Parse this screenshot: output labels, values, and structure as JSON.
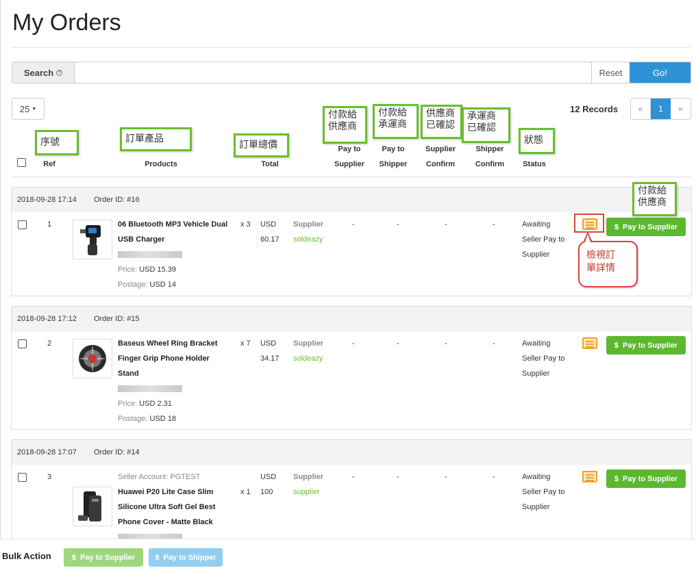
{
  "page": {
    "title": "My Orders"
  },
  "search": {
    "label": "Search",
    "placeholder": "",
    "reset_label": "Reset",
    "go_label": "Go!"
  },
  "pagination": {
    "page_size": "25",
    "records": "12 Records",
    "prev": "«",
    "current": "1",
    "next": "»"
  },
  "columns": {
    "ref": "Ref",
    "products": "Products",
    "total": "Total",
    "pay_to_supplier_1": "Pay to",
    "pay_to_supplier_2": "Supplier",
    "pay_to_shipper_1": "Pay to",
    "pay_to_shipper_2": "Shipper",
    "supplier_confirm_1": "Supplier",
    "supplier_confirm_2": "Confirm",
    "shipper_confirm_1": "Shipper",
    "shipper_confirm_2": "Confirm",
    "status": "Status"
  },
  "annotations": {
    "ref": "序號",
    "products": "訂單產品",
    "total": "訂單總價",
    "pay_supplier_1": "付款給",
    "pay_supplier_2": "供應商",
    "pay_shipper_1": "付款給",
    "pay_shipper_2": "承運商",
    "supplier_confirm_1": "供應商",
    "supplier_confirm_2": "已確認",
    "shipper_confirm_1": "承運商",
    "shipper_confirm_2": "已確認",
    "status": "狀態",
    "pay_btn_1": "付款給",
    "pay_btn_2": "供應商",
    "view_detail_1": "檢視訂",
    "view_detail_2": "單詳情"
  },
  "orders": [
    {
      "date": "2018-09-28 17:14",
      "order_id": "Order ID: #16",
      "ref": "1",
      "name_1": "06 Bluetooth MP3 Vehicle Dual",
      "name_2": "USB Charger",
      "price_label": "Price:",
      "price": "USD 15.39",
      "postage_label": "Postage:",
      "postage": "USD 14",
      "qty": "x 3",
      "currency": "USD",
      "total": "60.17",
      "supplier_label": "Supplier",
      "supplier": "soldeazy",
      "dash": "-",
      "status_1": "Awaiting",
      "status_2": "Seller Pay to",
      "status_3": "Supplier",
      "pay_label": "Pay to Supplier"
    },
    {
      "date": "2018-09-28 17:12",
      "order_id": "Order ID: #15",
      "ref": "2",
      "name_1": "Baseus Wheel Ring Bracket",
      "name_2": "Finger Grip Phone Holder",
      "name_3": "Stand",
      "price_label": "Price:",
      "price": "USD 2.31",
      "postage_label": "Postage:",
      "postage": "USD 18",
      "qty": "x 7",
      "currency": "USD",
      "total": "34.17",
      "supplier_label": "Supplier",
      "supplier": "soldeazy",
      "dash": "-",
      "status_1": "Awaiting",
      "status_2": "Seller Pay to",
      "status_3": "Supplier",
      "pay_label": "Pay to Supplier"
    },
    {
      "date": "2018-09-28 17:07",
      "order_id": "Order ID: #14",
      "ref": "3",
      "seller_account": "Seller Account: PGTEST",
      "name_1": "Huawei P20 Lite Case Slim",
      "name_2": "Silicone Ultra Soft Gel Best",
      "name_3": "Phone Cover - Matte Black",
      "qty": "x 1",
      "currency": "USD",
      "total": "100",
      "supplier_label": "Supplier",
      "supplier": "supplier",
      "dash": "-",
      "status_1": "Awaiting",
      "status_2": "Seller Pay to",
      "status_3": "Supplier",
      "pay_label": "Pay to Supplier"
    }
  ],
  "bulk": {
    "label": "Bulk Action",
    "pay_supplier": "Pay to Supplier",
    "pay_shipper": "Pay to Shipper"
  },
  "icons": {
    "dollar": "$",
    "help": "?",
    "caret": "▼"
  },
  "colors": {
    "primary": "#2d93d6",
    "success": "#5cb82f",
    "annotation_border": "#6abd2b",
    "callout_border": "#d9443f",
    "detail_icon": "#f0a030"
  }
}
